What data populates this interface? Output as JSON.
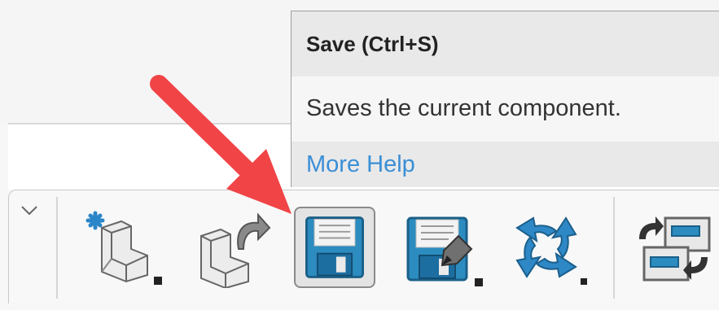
{
  "tooltip": {
    "title": "Save (Ctrl+S)",
    "description": "Saves the current component.",
    "more_help": "More Help"
  },
  "toolbar": {
    "buttons": [
      {
        "name": "new-component",
        "icon": "new-component-icon"
      },
      {
        "name": "open-component",
        "icon": "open-component-icon"
      },
      {
        "name": "save",
        "icon": "floppy-disk-icon",
        "active": true
      },
      {
        "name": "save-as",
        "icon": "save-as-icon"
      },
      {
        "name": "rebuild",
        "icon": "rebuild-icon"
      },
      {
        "name": "replace-component",
        "icon": "replace-component-icon"
      }
    ]
  },
  "colors": {
    "arrow": "#f04447",
    "accent": "#3a8fd6",
    "floppy": "#2c8cc0"
  }
}
